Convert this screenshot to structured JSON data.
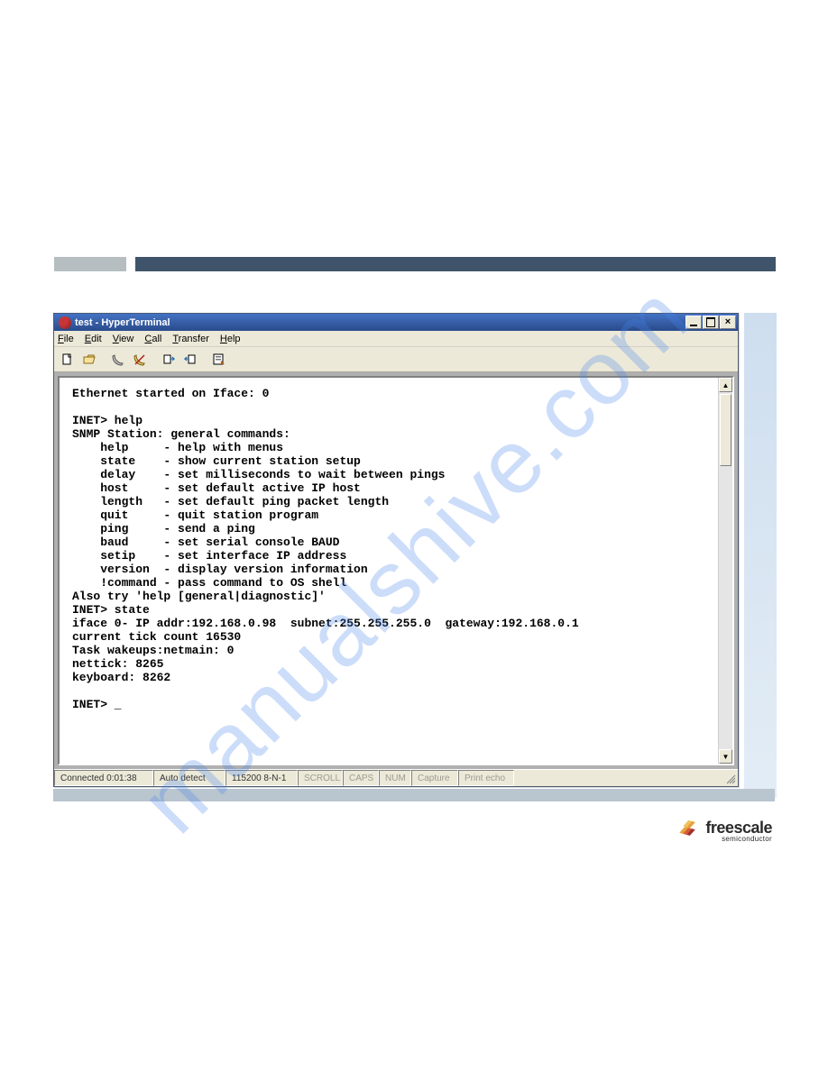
{
  "watermark": "manualshive.com",
  "window": {
    "title": "test - HyperTerminal"
  },
  "menu": {
    "file": "File",
    "edit": "Edit",
    "view": "View",
    "call": "Call",
    "transfer": "Transfer",
    "help": "Help"
  },
  "toolbar": {
    "new": "new-file",
    "open": "open-file",
    "connect": "connect",
    "disconnect": "disconnect",
    "send": "send",
    "receive": "receive",
    "properties": "properties"
  },
  "terminal": {
    "content": "Ethernet started on Iface: 0\n\nINET> help\nSNMP Station: general commands:\n    help     - help with menus\n    state    - show current station setup\n    delay    - set milliseconds to wait between pings\n    host     - set default active IP host\n    length   - set default ping packet length\n    quit     - quit station program\n    ping     - send a ping\n    baud     - set serial console BAUD\n    setip    - set interface IP address\n    version  - display version information\n    !command - pass command to OS shell\nAlso try 'help [general|diagnostic]'\nINET> state\niface 0- IP addr:192.168.0.98  subnet:255.255.255.0  gateway:192.168.0.1\ncurrent tick count 16530\nTask wakeups:netmain: 0\nnettick: 8265\nkeyboard: 8262\n\nINET> _"
  },
  "status": {
    "connected": "Connected 0:01:38",
    "detect": "Auto detect",
    "baud": "115200 8-N-1",
    "scroll": "SCROLL",
    "caps": "CAPS",
    "num": "NUM",
    "capture": "Capture",
    "echo": "Print echo"
  },
  "footer": {
    "brand": "freescale",
    "tag": "semiconductor"
  }
}
